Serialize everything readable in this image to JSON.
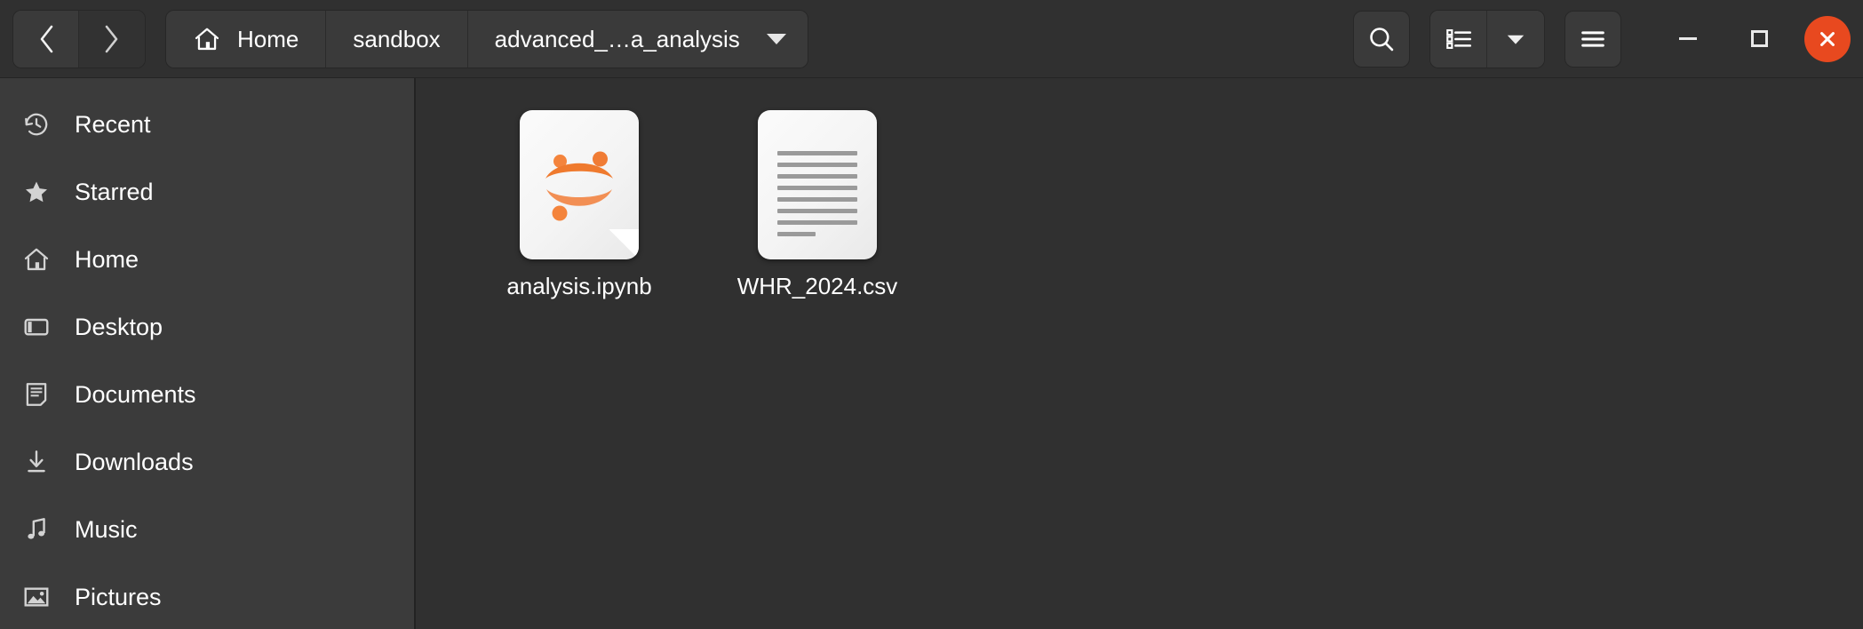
{
  "window": {
    "app": "files-manager",
    "colors": {
      "headerbar_bg": "#303030",
      "sidebar_bg": "#3b3b3b",
      "main_bg": "#303030",
      "button_bg": "#3a3a3a",
      "accent_close": "#e8491f",
      "text": "#ffffff",
      "jupyter_orange": "#f37726"
    }
  },
  "header": {
    "nav": {
      "back_icon": "chevron-left-icon",
      "forward_icon": "chevron-right-icon"
    },
    "pathbar": {
      "crumbs": [
        {
          "icon": "home-icon",
          "label": "Home"
        },
        {
          "icon": "",
          "label": "sandbox"
        },
        {
          "icon": "",
          "label": "advanced_…a_analysis",
          "has_dropdown": true
        }
      ]
    },
    "actions": [
      {
        "name": "search-button",
        "icon": "search-icon"
      },
      {
        "name": "view-list-button",
        "icon": "list-view-icon"
      },
      {
        "name": "view-options-button",
        "icon": "chevron-down-icon"
      },
      {
        "name": "main-menu-button",
        "icon": "hamburger-menu-icon"
      }
    ],
    "window_controls": [
      {
        "name": "minimize-button",
        "icon": "minimize-icon"
      },
      {
        "name": "maximize-button",
        "icon": "maximize-icon"
      },
      {
        "name": "close-button",
        "icon": "close-icon"
      }
    ]
  },
  "sidebar": {
    "items": [
      {
        "label": "Recent",
        "icon": "clock-history-icon"
      },
      {
        "label": "Starred",
        "icon": "star-icon"
      },
      {
        "label": "Home",
        "icon": "home-icon"
      },
      {
        "label": "Desktop",
        "icon": "desktop-icon"
      },
      {
        "label": "Documents",
        "icon": "document-icon"
      },
      {
        "label": "Downloads",
        "icon": "download-arrow-icon"
      },
      {
        "label": "Music",
        "icon": "music-note-icon"
      },
      {
        "label": "Pictures",
        "icon": "picture-icon"
      }
    ]
  },
  "main": {
    "files": [
      {
        "name": "analysis.ipynb",
        "icon": "jupyter-notebook-file-icon",
        "type": "ipynb"
      },
      {
        "name": "WHR_2024.csv",
        "icon": "text-file-icon",
        "type": "csv"
      }
    ]
  }
}
